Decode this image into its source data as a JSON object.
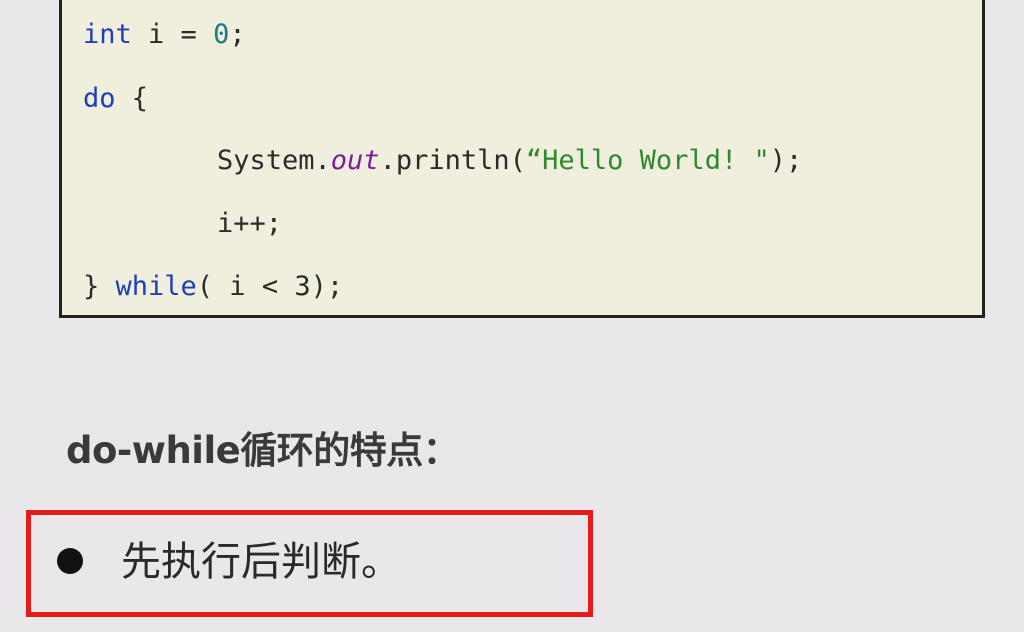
{
  "code": {
    "line1": {
      "kw": "int",
      "rest_a": " i = ",
      "num": "0",
      "rest_b": ";"
    },
    "line2": {
      "kw": "do",
      "rest": " {"
    },
    "line3": {
      "pre": "System.",
      "field": "out",
      "mid": ".println(",
      "str": "“Hello World! \"",
      "post": ");"
    },
    "line4": {
      "text": "i++;"
    },
    "line5": {
      "pre": "} ",
      "kw": "while",
      "rest": "( i < 3);"
    }
  },
  "heading": "do-while循环的特点：",
  "bullet": {
    "text": "先执行后判断。"
  },
  "colors": {
    "background": "#e9e7ea",
    "code_background": "#f0eedc",
    "keyword": "#1f3fb8",
    "number": "#1f7b84",
    "field": "#7a1fa0",
    "string": "#2f8a2f",
    "highlight_border": "#e51c1c"
  }
}
